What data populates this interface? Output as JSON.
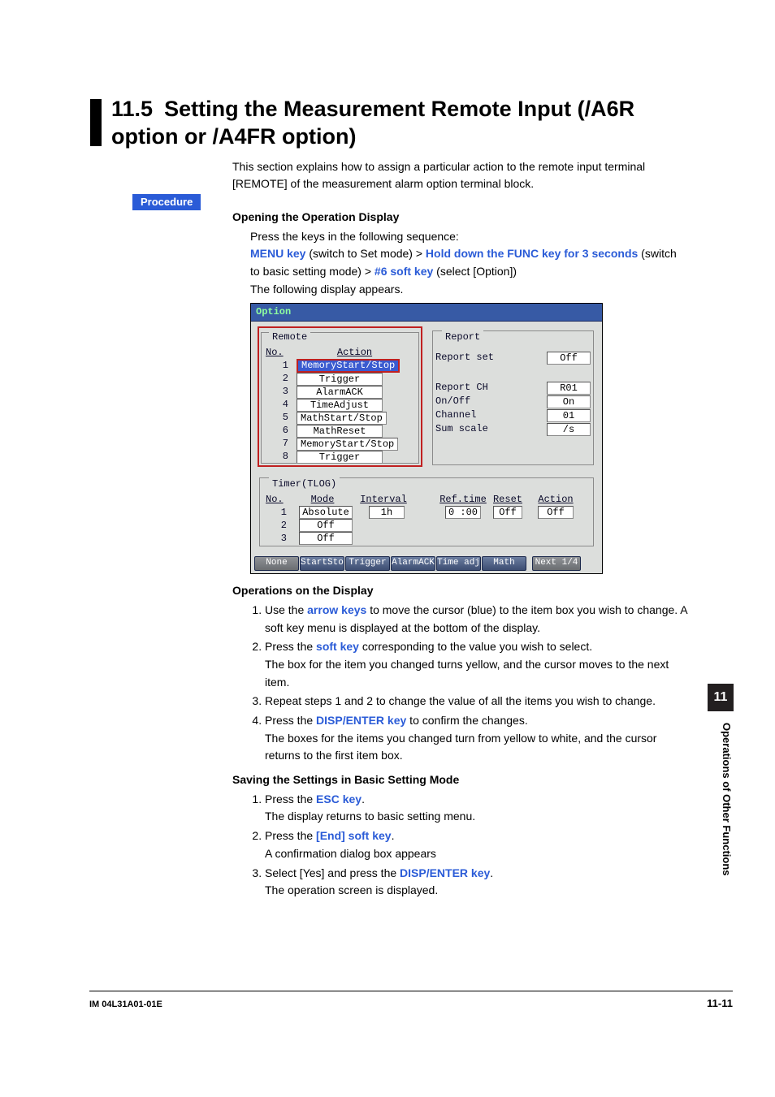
{
  "heading": {
    "number": "11.5",
    "title_line1": "Setting the Measurement Remote Input (/A6R",
    "title_line2": "option or /A4FR option)"
  },
  "intro": "This section explains how to assign a particular action to the remote input terminal [REMOTE] of the measurement alarm option terminal block.",
  "labels": {
    "procedure": "Procedure",
    "opening_heading": "Opening the Operation Display",
    "press_sequence": "Press the keys in the following sequence:",
    "kseq_menu_key": "MENU key",
    "kseq_menu_after": " (switch to Set mode) > ",
    "kseq_func_key": "Hold down the FUNC key for 3 seconds",
    "kseq_func_after": " (switch to basic setting mode) > ",
    "kseq_six_key": "#6 soft key",
    "kseq_six_after": " (select [Option])",
    "following_display": "The following display appears.",
    "ops_heading": "Operations on the Display",
    "saving_heading": "Saving the Settings in Basic Setting Mode"
  },
  "ops_steps": {
    "s1a": "Use the ",
    "s1key": "arrow keys",
    "s1b": " to move the cursor (blue) to the item box you wish to change. A soft key menu is displayed at the bottom of the display.",
    "s2a": "Press the ",
    "s2key": "soft key",
    "s2b": " corresponding to the value you wish to select.",
    "s2c": "The box for the item you changed turns yellow, and the cursor moves to the next item.",
    "s3": "Repeat steps 1 and 2 to change the value of all the items you wish to change.",
    "s4a": "Press the ",
    "s4key": "DISP/ENTER key",
    "s4b": " to confirm the changes.",
    "s4c": "The boxes for the items you changed turn from yellow to white, and the cursor returns to the first item box."
  },
  "save_steps": {
    "s1a": "Press the ",
    "s1key": "ESC key",
    "s1b": ".",
    "s1c": "The display returns to basic setting menu.",
    "s2a": "Press the ",
    "s2key": "[End] soft key",
    "s2b": ".",
    "s2c": "A confirmation dialog box appears",
    "s3a": "Select [Yes] and press the ",
    "s3key": "DISP/ENTER key",
    "s3b": ".",
    "s3c": "The operation screen is displayed."
  },
  "device": {
    "title": "Option",
    "remote": {
      "group_title": "Remote",
      "col_no": "No.",
      "col_action": "Action",
      "rows": [
        {
          "no": "1",
          "action": "MemoryStart/Stop",
          "selected": true
        },
        {
          "no": "2",
          "action": "Trigger"
        },
        {
          "no": "3",
          "action": "AlarmACK"
        },
        {
          "no": "4",
          "action": "TimeAdjust"
        },
        {
          "no": "5",
          "action": "MathStart/Stop"
        },
        {
          "no": "6",
          "action": "MathReset"
        },
        {
          "no": "7",
          "action": "MemoryStart/Stop"
        },
        {
          "no": "8",
          "action": "Trigger"
        }
      ]
    },
    "report": {
      "group_title": "Report",
      "rows_top": [
        {
          "label": "Report set",
          "value": "Off"
        }
      ],
      "rows_bottom": [
        {
          "label": "Report CH",
          "value": "R01"
        },
        {
          "label": "On/Off",
          "value": "On"
        },
        {
          "label": "Channel",
          "value": "01"
        },
        {
          "label": "Sum scale",
          "value": "/s"
        }
      ]
    },
    "tlog": {
      "group_title": "Timer(TLOG)",
      "cols": {
        "no": "No.",
        "mode": "Mode",
        "interval": "Interval",
        "ref": "Ref.time",
        "reset": "Reset",
        "action": "Action"
      },
      "rows": [
        {
          "no": "1",
          "mode": "Absolute",
          "interval": "1h",
          "ref": "0 :00",
          "reset": "Off",
          "action": "Off"
        },
        {
          "no": "2",
          "mode": "Off"
        },
        {
          "no": "3",
          "mode": "Off"
        }
      ]
    },
    "softkeys": [
      "None",
      "StartStop",
      "Trigger",
      "AlarmACK",
      "Time adj",
      "Math",
      "Next 1/4"
    ]
  },
  "tab": {
    "chapter": "11",
    "side_label": "Operations of Other Functions"
  },
  "footer": {
    "left": "IM 04L31A01-01E",
    "right": "11-11"
  }
}
